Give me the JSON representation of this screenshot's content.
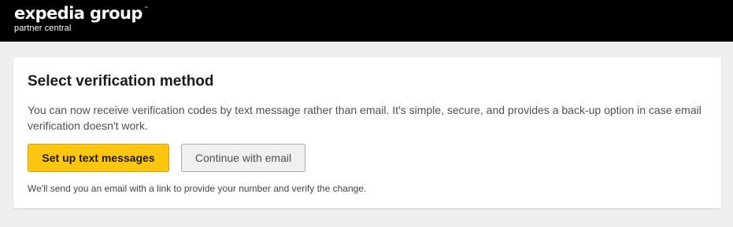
{
  "header": {
    "brand_name": "expedia group",
    "brand_trademark": "™",
    "brand_subtitle": "partner central"
  },
  "card": {
    "title": "Select verification method",
    "body": "You can now receive verification codes by text message rather than email. It's simple, secure, and provides a back-up option in case email verification doesn't work.",
    "primary_button_label": "Set up text messages",
    "secondary_button_label": "Continue with email",
    "note": "We'll send you an email with a link to provide your number and verify the change."
  },
  "colors": {
    "header_background": "#000000",
    "page_background": "#efefef",
    "primary_button": "#ffc50f",
    "secondary_button": "#f0f0f0"
  }
}
